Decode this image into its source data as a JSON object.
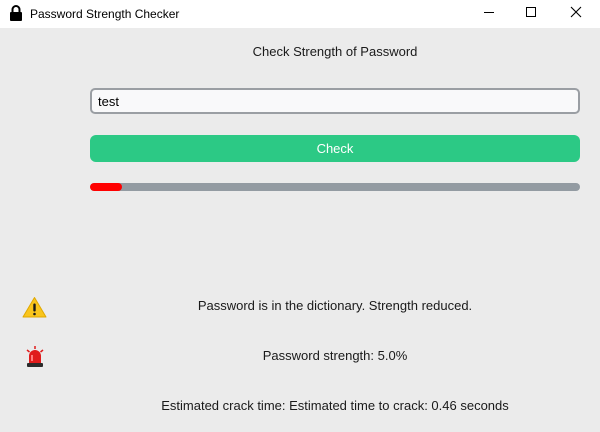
{
  "window": {
    "title": "Password Strength Checker",
    "app_icon": "padlock-icon",
    "controls": [
      "minimize-icon",
      "maximize-icon",
      "close-icon"
    ]
  },
  "main": {
    "heading": "Check Strength of Password",
    "password_input": {
      "value": "test",
      "placeholder": ""
    },
    "check_button": {
      "label": "Check",
      "color": "#2cc985"
    },
    "strength_progress": {
      "fraction": 0.05,
      "fill_color": "#ff0000",
      "track_color": "#939ba2"
    }
  },
  "messages": {
    "dictionary_warning": {
      "icon": "warning-icon",
      "text": "Password is in the dictionary. Strength reduced."
    },
    "strength": {
      "icon": "siren-icon",
      "text": "Password strength: 5.0%"
    },
    "crack_time": {
      "text": "Estimated crack time: Estimated time to crack: 0.46 seconds"
    }
  }
}
